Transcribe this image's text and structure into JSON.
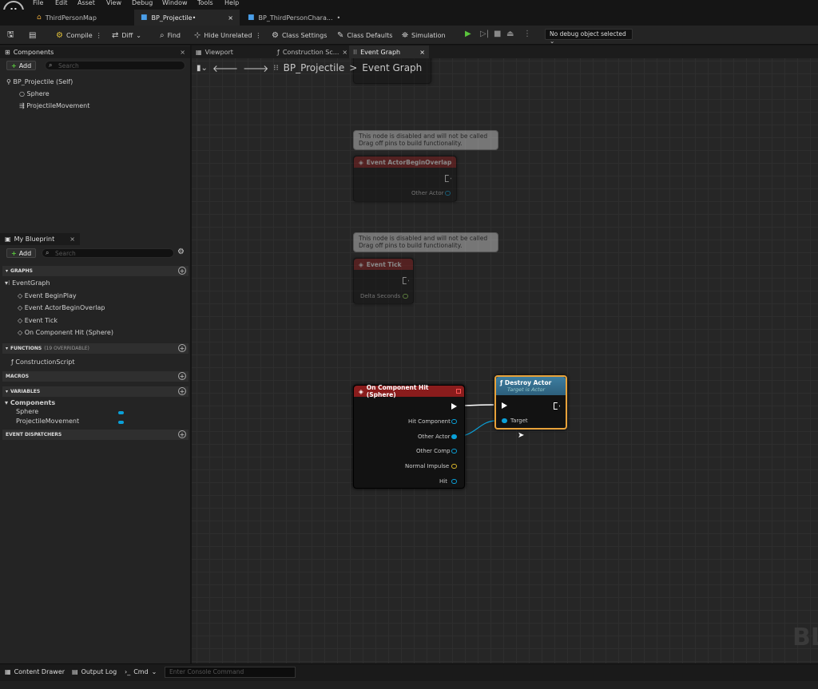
{
  "menu": [
    "File",
    "Edit",
    "Asset",
    "View",
    "Debug",
    "Window",
    "Tools",
    "Help"
  ],
  "logo": "U",
  "tabs": [
    {
      "label": "ThirdPersonMap"
    },
    {
      "label": "BP_Projectile•"
    },
    {
      "label": "BP_ThirdPersonChara...",
      "dot": "•"
    }
  ],
  "toolbar": {
    "compile": "Compile",
    "diff": "Diff",
    "find": "Find",
    "hide_unrelated": "Hide Unrelated",
    "class_settings": "Class Settings",
    "class_defaults": "Class Defaults",
    "simulation": "Simulation",
    "debug_select": "No debug object selected"
  },
  "components": {
    "title": "Components",
    "add": "Add",
    "search_placeholder": "Search",
    "items": [
      "BP_Projectile (Self)",
      "Sphere",
      "ProjectileMovement"
    ]
  },
  "myblueprint": {
    "title": "My Blueprint",
    "add": "Add",
    "search_placeholder": "Search",
    "graphs_label": "GRAPHS",
    "event_graph": "EventGraph",
    "events": [
      "Event BeginPlay",
      "Event ActorBeginOverlap",
      "Event Tick",
      "On Component Hit (Sphere)"
    ],
    "functions_label": "FUNCTIONS",
    "functions_note": "(19 OVERRIDABLE)",
    "construction": "ConstructionScript",
    "macros_label": "MACROS",
    "variables_label": "VARIABLES",
    "components_cat": "Components",
    "vars": [
      "Sphere",
      "ProjectileMovement"
    ],
    "dispatchers_label": "EVENT DISPATCHERS"
  },
  "graph_tabs": [
    "Viewport",
    "Construction Sc...",
    "Event Graph"
  ],
  "breadcrumb": {
    "root": "BP_Projectile",
    "sep": ">",
    "current": "Event Graph"
  },
  "comment_text": [
    "This node is disabled and will not be called",
    "Drag off pins to build functionality."
  ],
  "nodes": {
    "overlap": {
      "title": "Event ActorBeginOverlap",
      "pin": "Other Actor"
    },
    "tick": {
      "title": "Event Tick",
      "pin": "Delta Seconds"
    },
    "hit": {
      "title": "On Component Hit (Sphere)",
      "pins": [
        "Hit Component",
        "Other Actor",
        "Other Comp",
        "Normal Impulse",
        "Hit"
      ]
    },
    "destroy": {
      "title": "Destroy Actor",
      "subtitle": "Target is Actor",
      "pin": "Target"
    }
  },
  "watermark": "BL",
  "bottom": {
    "content_drawer": "Content Drawer",
    "output_log": "Output Log",
    "cmd": "Cmd",
    "console_placeholder": "Enter Console Command"
  },
  "colors": {
    "event_red": "#8a1c1c",
    "function_blue": "#2d6a8a",
    "object_pin": "#0aa0d8",
    "vector_pin": "#d9b52a",
    "float_pin": "#9be15a",
    "selected": "#e8a23a"
  }
}
